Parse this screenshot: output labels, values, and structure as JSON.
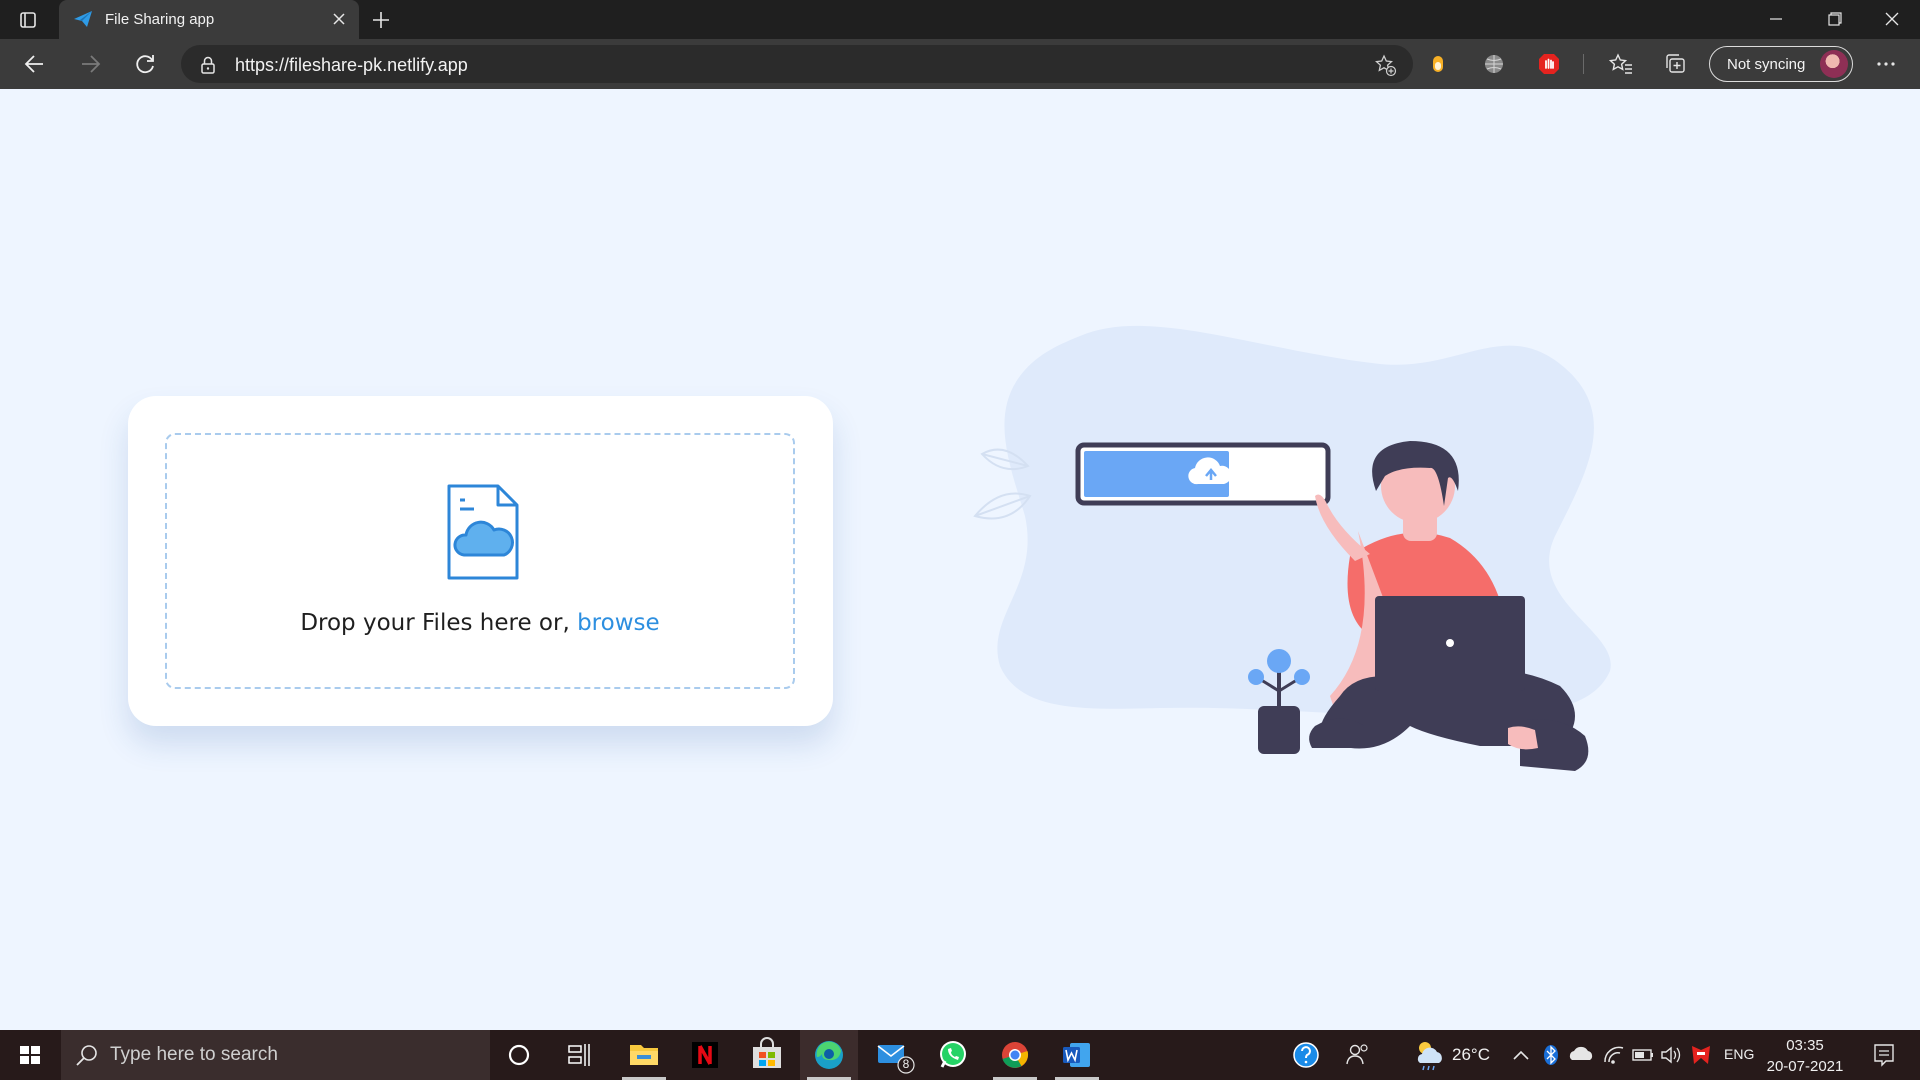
{
  "browser": {
    "tab_title": "File Sharing app",
    "url": "https://fileshare-pk.netlify.app",
    "sync_label": "Not syncing"
  },
  "upload": {
    "drop_text": "Drop your Files here or, ",
    "browse_link": "browse"
  },
  "taskbar": {
    "search_placeholder": "Type here to search",
    "mail_badge": "8",
    "weather_temp": "26°C",
    "language": "ENG",
    "time": "03:35",
    "date": "20-07-2021"
  },
  "icons": {
    "tab_actions": "tab-actions-icon",
    "favicon": "paper-plane-icon",
    "back": "back-arrow-icon",
    "forward": "forward-arrow-icon",
    "refresh": "refresh-icon",
    "lock": "lock-icon",
    "add_favorite": "add-favorite-icon",
    "favorites": "favorites-icon",
    "collections": "collections-icon",
    "upload_file": "cloud-file-icon"
  },
  "colors": {
    "page_background": "#eef5ff",
    "accent_blue": "#2d8fe0",
    "dropzone_border": "#a9cbed",
    "illustration_person_shirt": "#f56d6a",
    "illustration_dark": "#3f3d56"
  }
}
